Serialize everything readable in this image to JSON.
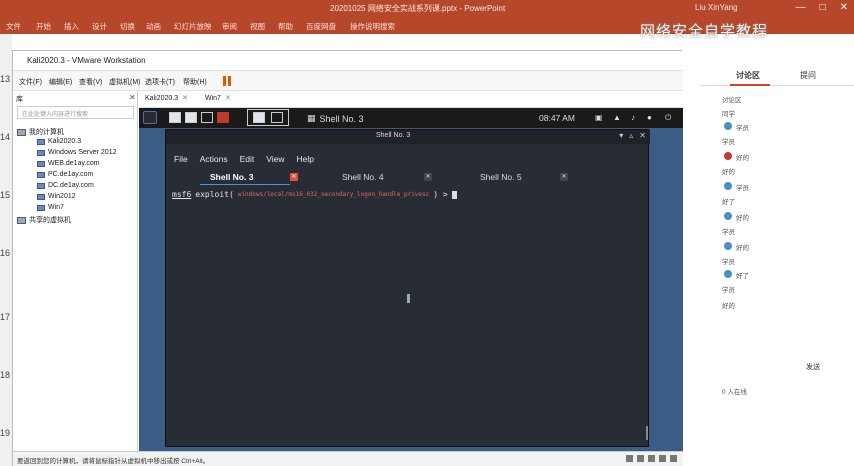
{
  "ppt": {
    "title": "20201025 网络安全实战系列课.pptx - PowerPoint",
    "user": "Liu XinYang",
    "ribbon_tabs": [
      "文件",
      "开始",
      "插入",
      "设计",
      "切换",
      "动画",
      "幻灯片放映",
      "审阅",
      "视图",
      "帮助",
      "百度网盘",
      "操作说明搜索"
    ],
    "watermark": "网络安全自学教程",
    "slide_numbers": [
      "13",
      "14",
      "15",
      "16",
      "17",
      "18",
      "19"
    ]
  },
  "discussion": {
    "tab_active": "讨论区",
    "tab_other": "提问",
    "messages": [
      "讨论区",
      "同学",
      "学员",
      "学员",
      "好的",
      "好的",
      "学员",
      "好了",
      "好的",
      "学员",
      "好的",
      "学员",
      "好了",
      "学员",
      "好的"
    ],
    "send_label": "发送",
    "footer": "0 人在线"
  },
  "vmware": {
    "title": "Kali2020.3 - VMware Workstation",
    "menu": [
      "文件(F)",
      "编辑(E)",
      "查看(V)",
      "虚拟机(M)",
      "选项卡(T)",
      "帮助(H)"
    ],
    "library_title": "库",
    "search_placeholder": "在此处键入内容进行搜索",
    "tree": [
      {
        "label": "我的计算机",
        "level": 0
      },
      {
        "label": "Kali2020.3",
        "level": 1
      },
      {
        "label": "Windows Server 2012",
        "level": 1
      },
      {
        "label": "WEB.de1ay.com",
        "level": 1
      },
      {
        "label": "PC.de1ay.com",
        "level": 1
      },
      {
        "label": "DC.de1ay.com",
        "level": 1
      },
      {
        "label": "Win2012",
        "level": 1
      },
      {
        "label": "Win7",
        "level": 1
      },
      {
        "label": "共享的虚拟机",
        "level": 0
      }
    ],
    "tabs": [
      "Kali2020.3",
      "Win7"
    ],
    "status": "要返回到您的计算机，请将鼠标指针从虚拟机中移出或按 Ctrl+Alt。"
  },
  "kali": {
    "panel_title": "Shell No. 3",
    "clock": "08:47 AM",
    "terminal": {
      "title": "Shell No. 3",
      "menu": [
        "File",
        "Actions",
        "Edit",
        "View",
        "Help"
      ],
      "tabs": [
        "Shell No. 3",
        "Shell No. 4",
        "Shell No. 5"
      ],
      "prompt_prefix": "msf6",
      "prompt_cmd": "exploit(",
      "prompt_module": "windows/local/ms16_032_secondary_logon_handle_privesc",
      "prompt_suffix": ") >"
    }
  }
}
